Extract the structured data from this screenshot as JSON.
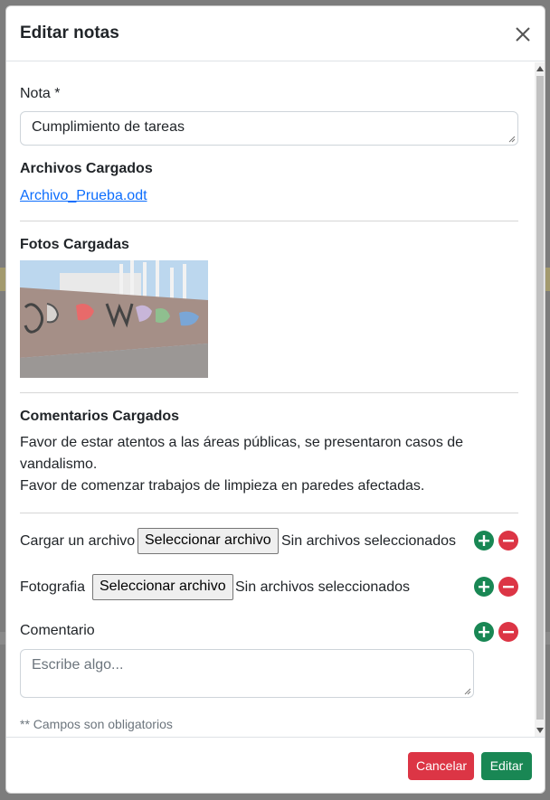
{
  "modal": {
    "title": "Editar notas",
    "close_icon": "close-icon"
  },
  "nota": {
    "label": "Nota *",
    "value": "Cumplimiento de tareas"
  },
  "archivos": {
    "heading": "Archivos Cargados",
    "file_link": "Archivo_Prueba.odt"
  },
  "fotos": {
    "heading": "Fotos Cargadas",
    "image": "graffiti-wall-photo"
  },
  "comentarios": {
    "heading": "Comentarios Cargados",
    "lines": [
      "Favor de estar atentos a las áreas públicas, se presentaron casos de vandalismo.",
      "Favor de comenzar trabajos de limpieza en paredes afectadas."
    ]
  },
  "upload_file": {
    "label": "Cargar un archivo",
    "button": "Seleccionar archivo",
    "status": "Sin archivos seleccionados"
  },
  "upload_photo": {
    "label": "Fotografia",
    "button": "Seleccionar archivo",
    "status": "Sin archivos seleccionados"
  },
  "comentario": {
    "label": "Comentario",
    "placeholder": "Escribe algo..."
  },
  "note": "** Campos son obligatorios",
  "footer": {
    "cancel": "Cancelar",
    "edit": "Editar"
  },
  "colors": {
    "add": "#198754",
    "remove": "#dc3545",
    "link": "#0d6efd"
  },
  "icons": {
    "add": "plus-circle-icon",
    "remove": "minus-circle-icon"
  }
}
